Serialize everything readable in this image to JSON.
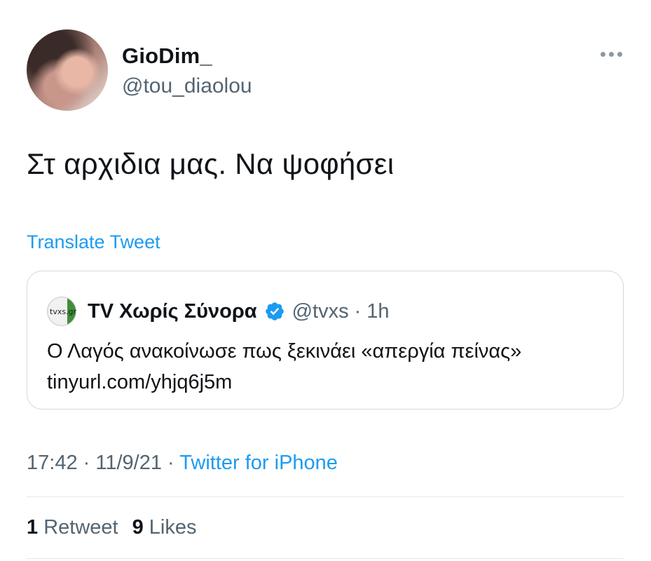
{
  "author": {
    "display_name": "GioDim_",
    "handle": "@tou_diaolou"
  },
  "tweet": {
    "text": "Στ αρχιδια μας. Να ψοφήσει",
    "translate_label": "Translate Tweet"
  },
  "quoted_tweet": {
    "avatar_text": "tvxs.gr",
    "display_name": "TV Χωρίς Σύνορα",
    "handle": "@tvxs",
    "separator": "·",
    "time": "1h",
    "text": "Ο Λαγός ανακοίνωσε πως ξεκινάει «απεργία πείνας» tinyurl.com/yhjq6j5m"
  },
  "meta": {
    "time": "17:42",
    "separator": "·",
    "date": "11/9/21",
    "source": "Twitter for iPhone"
  },
  "stats": {
    "retweets_count": "1",
    "retweets_label": "Retweet",
    "likes_count": "9",
    "likes_label": "Likes"
  },
  "colors": {
    "accent": "#1d9bf0",
    "text": "#0f1419",
    "secondary": "#536471",
    "border": "#cfd9de"
  }
}
